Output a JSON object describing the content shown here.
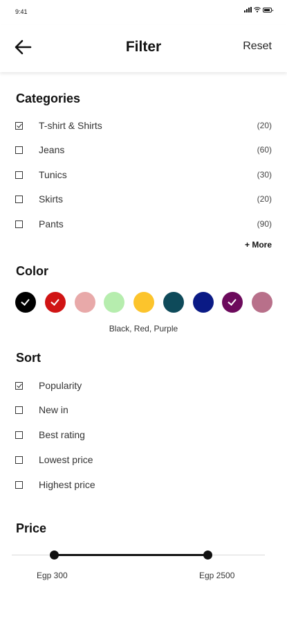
{
  "status": {
    "time": "9:41"
  },
  "header": {
    "title": "Filter",
    "reset": "Reset"
  },
  "categories": {
    "title": "Categories",
    "items": [
      {
        "label": "T-shirt & Shirts",
        "count": "(20)",
        "checked": true
      },
      {
        "label": "Jeans",
        "count": "(60)",
        "checked": false
      },
      {
        "label": "Tunics",
        "count": "(30)",
        "checked": false
      },
      {
        "label": "Skirts",
        "count": "(20)",
        "checked": false
      },
      {
        "label": "Pants",
        "count": "(90)",
        "checked": false
      }
    ],
    "more": "+ More"
  },
  "color": {
    "title": "Color",
    "swatches": [
      {
        "hex": "#000000",
        "checked": true
      },
      {
        "hex": "#d01414",
        "checked": true
      },
      {
        "hex": "#e8a9a9",
        "checked": false
      },
      {
        "hex": "#b6edae",
        "checked": false
      },
      {
        "hex": "#fcc42c",
        "checked": false
      },
      {
        "hex": "#0e4a5a",
        "checked": false
      },
      {
        "hex": "#0a1a85",
        "checked": false
      },
      {
        "hex": "#6c0a5c",
        "checked": true
      },
      {
        "hex": "#b8708a",
        "checked": false
      }
    ],
    "selected": "Black, Red, Purple"
  },
  "sort": {
    "title": "Sort",
    "items": [
      {
        "label": "Popularity",
        "checked": true
      },
      {
        "label": "New in",
        "checked": false
      },
      {
        "label": "Best rating",
        "checked": false
      },
      {
        "label": "Lowest price",
        "checked": false
      },
      {
        "label": "Highest price",
        "checked": false
      }
    ]
  },
  "price": {
    "title": "Price",
    "min_label": "Egp 300",
    "max_label": "Egp 2500",
    "min_fraction": 0.167,
    "max_fraction": 0.773
  }
}
